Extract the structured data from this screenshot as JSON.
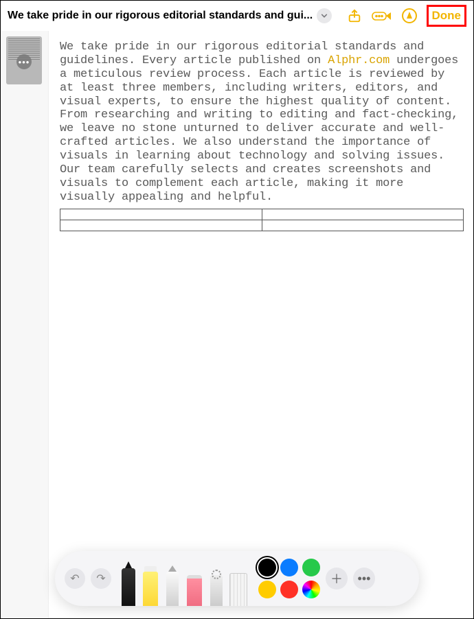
{
  "toolbar": {
    "title": "We take pride in our rigorous editorial standards and gui...",
    "done_label": "Done"
  },
  "content": {
    "text_before_link": "We take pride in our rigorous editorial standards and guidelines. Every article published on ",
    "link_text": "Alphr.com",
    "text_after_link": " undergoes a meticulous review process. Each article is reviewed by at least three members, including writers, editors, and visual experts, to ensure the highest quality of content. From researching and writing to editing and fact-checking, we leave no stone unturned to deliver accurate and well-crafted articles. We also understand the importance of visuals in learning about technology and solving issues. Our team carefully selects and creates screenshots and visuals to complement each article, making it more visually appealing and helpful."
  },
  "colors": {
    "black": "#000000",
    "blue": "#0a7cff",
    "green": "#26c94a",
    "yellow": "#ffcc00",
    "red": "#ff3126"
  }
}
